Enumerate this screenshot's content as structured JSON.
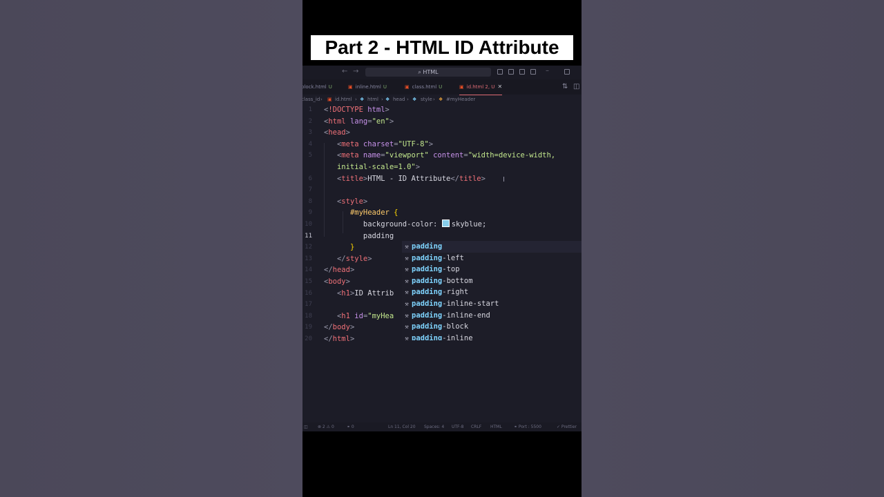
{
  "banner": {
    "title": "Part 2 - HTML ID Attribute"
  },
  "titlebar": {
    "search_label": "⌕ HTML"
  },
  "tabs": [
    {
      "label": "block.html",
      "badge": "U"
    },
    {
      "label": "inline.html",
      "badge": "U"
    },
    {
      "label": "class.html",
      "badge": "U"
    },
    {
      "label": "id.html 2, U",
      "badge": "",
      "active": true
    }
  ],
  "breadcrumb": [
    "class_id",
    "id.html",
    "html",
    "head",
    "style",
    "#myHeader"
  ],
  "code_lines": [
    {
      "n": "1",
      "html": "<span class='p'>&lt;</span><span class='t'>!DOCTYPE</span> <span class='a'>html</span><span class='p'>&gt;</span>"
    },
    {
      "n": "2",
      "html": "<span class='p'>&lt;</span><span class='t'>html</span> <span class='a'>lang</span><span class='p'>=</span><span class='s'>\"en\"</span><span class='p'>&gt;</span>"
    },
    {
      "n": "3",
      "html": "<span class='p'>&lt;</span><span class='t'>head</span><span class='p'>&gt;</span>"
    },
    {
      "n": "4",
      "html": "    <span class='p'>&lt;</span><span class='t'>meta</span> <span class='a'>charset</span><span class='p'>=</span><span class='s'>\"UTF-8\"</span><span class='p'>&gt;</span>"
    },
    {
      "n": "5",
      "html": "    <span class='p'>&lt;</span><span class='t'>meta</span> <span class='a'>name</span><span class='p'>=</span><span class='s'>\"viewport\"</span> <span class='a'>content</span><span class='p'>=</span><span class='s'>\"width=device-width,</span>"
    },
    {
      "n": "",
      "html": "    <span class='s'>initial-scale=1.0\"</span><span class='p'>&gt;</span>"
    },
    {
      "n": "6",
      "html": "    <span class='p'>&lt;</span><span class='t'>title</span><span class='p'>&gt;</span>HTML - ID Attribute<span class='p'>&lt;/</span><span class='t'>title</span><span class='p'>&gt;</span>"
    },
    {
      "n": "7",
      "html": ""
    },
    {
      "n": "8",
      "html": "    <span class='p'>&lt;</span><span class='t'>style</span><span class='p'>&gt;</span>"
    },
    {
      "n": "9",
      "html": "        <span class='sel'>#myHeader</span> <span class='br'>{</span>"
    },
    {
      "n": "10",
      "html": "            <span class='prop'>background-color:</span> <span class='swatch'></span><span class='val'>skyblue;</span>"
    },
    {
      "n": "11",
      "html": "            <span class='prop'>padding</span>",
      "current": true
    },
    {
      "n": "12",
      "html": "        <span class='br'>}</span>"
    },
    {
      "n": "13",
      "html": "    <span class='p'>&lt;/</span><span class='t'>style</span><span class='p'>&gt;</span>"
    },
    {
      "n": "14",
      "html": "<span class='p'>&lt;/</span><span class='t'>head</span><span class='p'>&gt;</span>"
    },
    {
      "n": "15",
      "html": "<span class='p'>&lt;</span><span class='t'>body</span><span class='p'>&gt;</span>"
    },
    {
      "n": "16",
      "html": "    <span class='p'>&lt;</span><span class='t'>h1</span><span class='p'>&gt;</span>ID Attrib"
    },
    {
      "n": "17",
      "html": ""
    },
    {
      "n": "18",
      "html": "    <span class='p'>&lt;</span><span class='t'>h1</span> <span class='a'>id</span><span class='p'>=</span><span class='s'>\"myHea</span>"
    },
    {
      "n": "19",
      "html": "<span class='p'>&lt;/</span><span class='t'>body</span><span class='p'>&gt;</span>"
    },
    {
      "n": "20",
      "html": "<span class='p'>&lt;/</span><span class='t'>html</span><span class='p'>&gt;</span>"
    }
  ],
  "suggestions": [
    {
      "match": "padding",
      "rest": ""
    },
    {
      "match": "padding",
      "rest": "-left"
    },
    {
      "match": "padding",
      "rest": "-top"
    },
    {
      "match": "padding",
      "rest": "-bottom"
    },
    {
      "match": "padding",
      "rest": "-right"
    },
    {
      "match": "padding",
      "rest": "-inline-start"
    },
    {
      "match": "padding",
      "rest": "-inline-end"
    },
    {
      "match": "padding",
      "rest": "-block"
    },
    {
      "match": "padding",
      "rest": "-inline"
    }
  ],
  "statusbar": {
    "errors": "⊗ 2 ⚠ 0",
    "ports": "⚭ 0",
    "position": "Ln 11, Col 20",
    "spaces": "Spaces: 4",
    "encoding": "UTF-8",
    "eol": "CRLF",
    "language": "HTML",
    "port": "⚭ Port : 5500",
    "formatter": "✓ Prettier"
  }
}
